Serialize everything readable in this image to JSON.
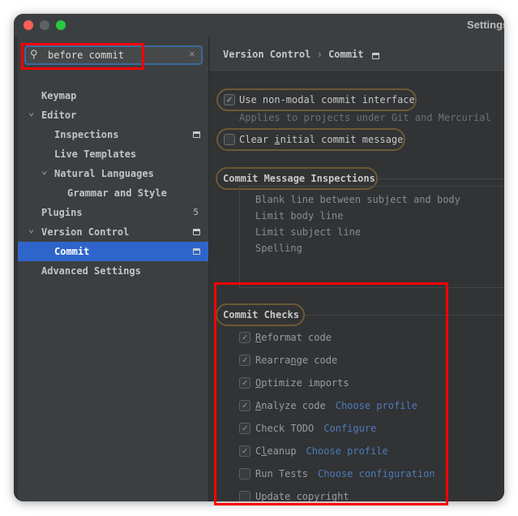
{
  "window": {
    "title": "Settings",
    "controls": {
      "close": "#fe5f57",
      "minimize": "#5f6163",
      "maximize": "#29c840"
    }
  },
  "search": {
    "value": "before commit",
    "icon": "search-icon",
    "clear_icon": "close-icon"
  },
  "sidebar": {
    "items": [
      {
        "label": "Keymap",
        "level": 0,
        "chevron": ""
      },
      {
        "label": "Editor",
        "level": 0,
        "chevron": "⌄"
      },
      {
        "label": "Inspections",
        "level": 1,
        "chevron": "",
        "page_icon": true
      },
      {
        "label": "Live Templates",
        "level": 1,
        "chevron": ""
      },
      {
        "label": "Natural Languages",
        "level": 1,
        "chevron": "⌄"
      },
      {
        "label": "Grammar and Style",
        "level": 2,
        "chevron": ""
      },
      {
        "label": "Plugins",
        "level": 0,
        "chevron": "",
        "badge": "5"
      },
      {
        "label": "Version Control",
        "level": 0,
        "chevron": "⌄",
        "page_icon": true
      },
      {
        "label": "Commit",
        "level": 1,
        "chevron": "",
        "page_icon": true,
        "selected": true
      },
      {
        "label": "Advanced Settings",
        "level": 0,
        "chevron": ""
      }
    ]
  },
  "main": {
    "breadcrumb": {
      "parent": "Version Control",
      "separator": "›",
      "current": "Commit"
    },
    "non_modal": {
      "label": "Use non-modal commit interface",
      "checked": true,
      "hint": "Applies to projects under Git and Mercurial"
    },
    "clear_initial": {
      "pre": "Clear ",
      "mn": "i",
      "post": "nitial commit message",
      "checked": false
    },
    "inspections": {
      "title": "Commit Message Inspections",
      "items": [
        "Blank line between subject and body",
        "Limit body line",
        "Limit subject line",
        "Spelling"
      ]
    },
    "checks": {
      "title": "Commit Checks",
      "items": [
        {
          "pre": "",
          "mn": "R",
          "post": "eformat code",
          "checked": true
        },
        {
          "pre": "Rearra",
          "mn": "n",
          "post": "ge code",
          "checked": true
        },
        {
          "pre": "",
          "mn": "O",
          "post": "ptimize imports",
          "checked": true
        },
        {
          "pre": "",
          "mn": "A",
          "post": "nalyze code",
          "checked": true,
          "link": "Choose profile"
        },
        {
          "pre": "Check TODO",
          "mn": "",
          "post": "",
          "checked": true,
          "link": "Configure"
        },
        {
          "pre": "C",
          "mn": "l",
          "post": "eanup",
          "checked": true,
          "link": "Choose profile"
        },
        {
          "pre": "Run Tests",
          "mn": "",
          "post": "",
          "checked": false,
          "link": "Choose configuration"
        },
        {
          "pre": "Update copyright",
          "mn": "",
          "post": "",
          "checked": false
        }
      ]
    }
  },
  "highlight_color": "#ff0000"
}
